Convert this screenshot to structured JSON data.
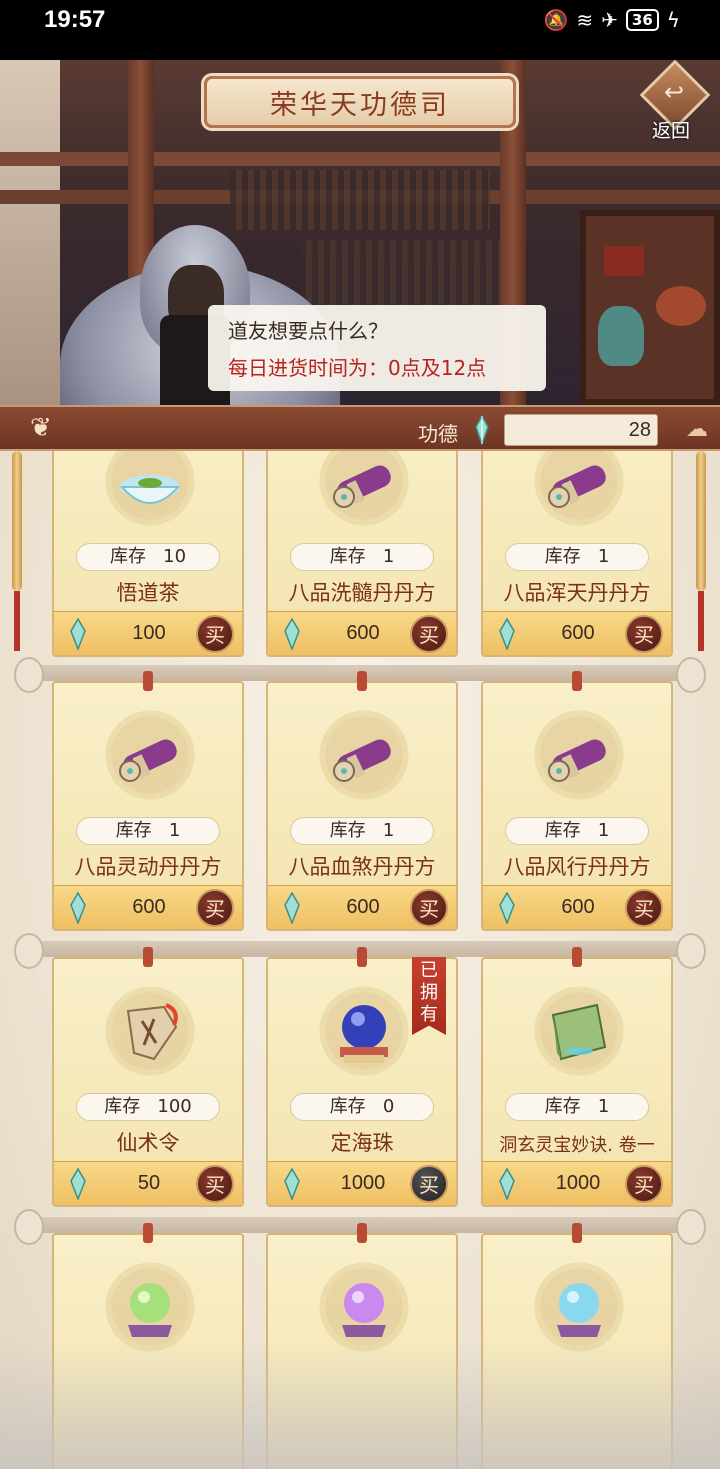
{
  "status_bar": {
    "time": "19:57",
    "battery": "36"
  },
  "header": {
    "title": "荣华天功德司",
    "return_label": "返回"
  },
  "npc": {
    "line1": "道友想要点什么？",
    "line2": "每日进货时间为：0点及12点"
  },
  "merit": {
    "label": "功德",
    "value": "28"
  },
  "items": [
    {
      "stock_label": "库存",
      "stock": "10",
      "name": "悟道茶",
      "price": "100",
      "buy": "买",
      "icon": "tea-bowl-icon"
    },
    {
      "stock_label": "库存",
      "stock": "1",
      "name": "八品洗髓丹丹方",
      "price": "600",
      "buy": "买",
      "icon": "recipe-scroll-icon"
    },
    {
      "stock_label": "库存",
      "stock": "1",
      "name": "八品浑天丹丹方",
      "price": "600",
      "buy": "买",
      "icon": "recipe-scroll-icon"
    },
    {
      "stock_label": "库存",
      "stock": "1",
      "name": "八品灵动丹丹方",
      "price": "600",
      "buy": "买",
      "icon": "recipe-scroll-icon"
    },
    {
      "stock_label": "库存",
      "stock": "1",
      "name": "八品血煞丹丹方",
      "price": "600",
      "buy": "买",
      "icon": "recipe-scroll-icon"
    },
    {
      "stock_label": "库存",
      "stock": "1",
      "name": "八品风行丹丹方",
      "price": "600",
      "buy": "买",
      "icon": "recipe-scroll-icon"
    },
    {
      "stock_label": "库存",
      "stock": "100",
      "name": "仙术令",
      "price": "50",
      "buy": "买",
      "icon": "token-icon"
    },
    {
      "stock_label": "库存",
      "stock": "0",
      "name": "定海珠",
      "price": "1000",
      "buy": "买",
      "icon": "crystal-orb-icon",
      "owned_tag": "已拥有"
    },
    {
      "stock_label": "库存",
      "stock": "1",
      "name": "洞玄灵宝妙诀. 卷一",
      "price": "1000",
      "buy": "买",
      "icon": "book-icon"
    }
  ],
  "colors": {
    "accent": "#7a3019",
    "merit_bar": "#6e3524",
    "price_bar": "#efbf63",
    "buy_btn": "#4a1712"
  }
}
